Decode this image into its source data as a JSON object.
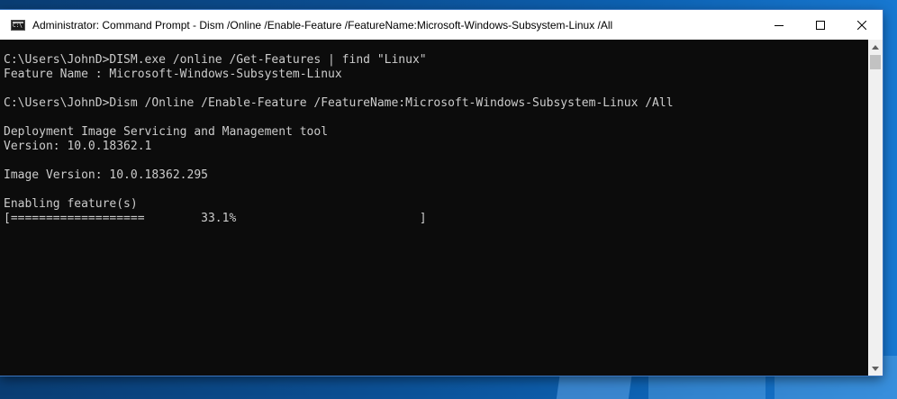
{
  "window": {
    "title": "Administrator: Command Prompt - Dism  /Online /Enable-Feature /FeatureName:Microsoft-Windows-Subsystem-Linux /All",
    "icon": "cmd-icon",
    "controls": {
      "minimize": "minimize-icon",
      "maximize": "maximize-icon",
      "close": "close-icon"
    }
  },
  "console": {
    "lines": [
      "C:\\Users\\JohnD>DISM.exe /online /Get-Features | find \"Linux\"",
      "Feature Name : Microsoft-Windows-Subsystem-Linux",
      "",
      "C:\\Users\\JohnD>Dism /Online /Enable-Feature /FeatureName:Microsoft-Windows-Subsystem-Linux /All",
      "",
      "Deployment Image Servicing and Management tool",
      "Version: 10.0.18362.1",
      "",
      "Image Version: 10.0.18362.295",
      "",
      "Enabling feature(s)",
      "[===================        33.1%                          ]"
    ],
    "text_color": "#cccccc",
    "background": "#0c0c0c"
  },
  "scrollbar": {
    "up": "scroll-up-arrow-icon",
    "down": "scroll-down-arrow-icon"
  }
}
